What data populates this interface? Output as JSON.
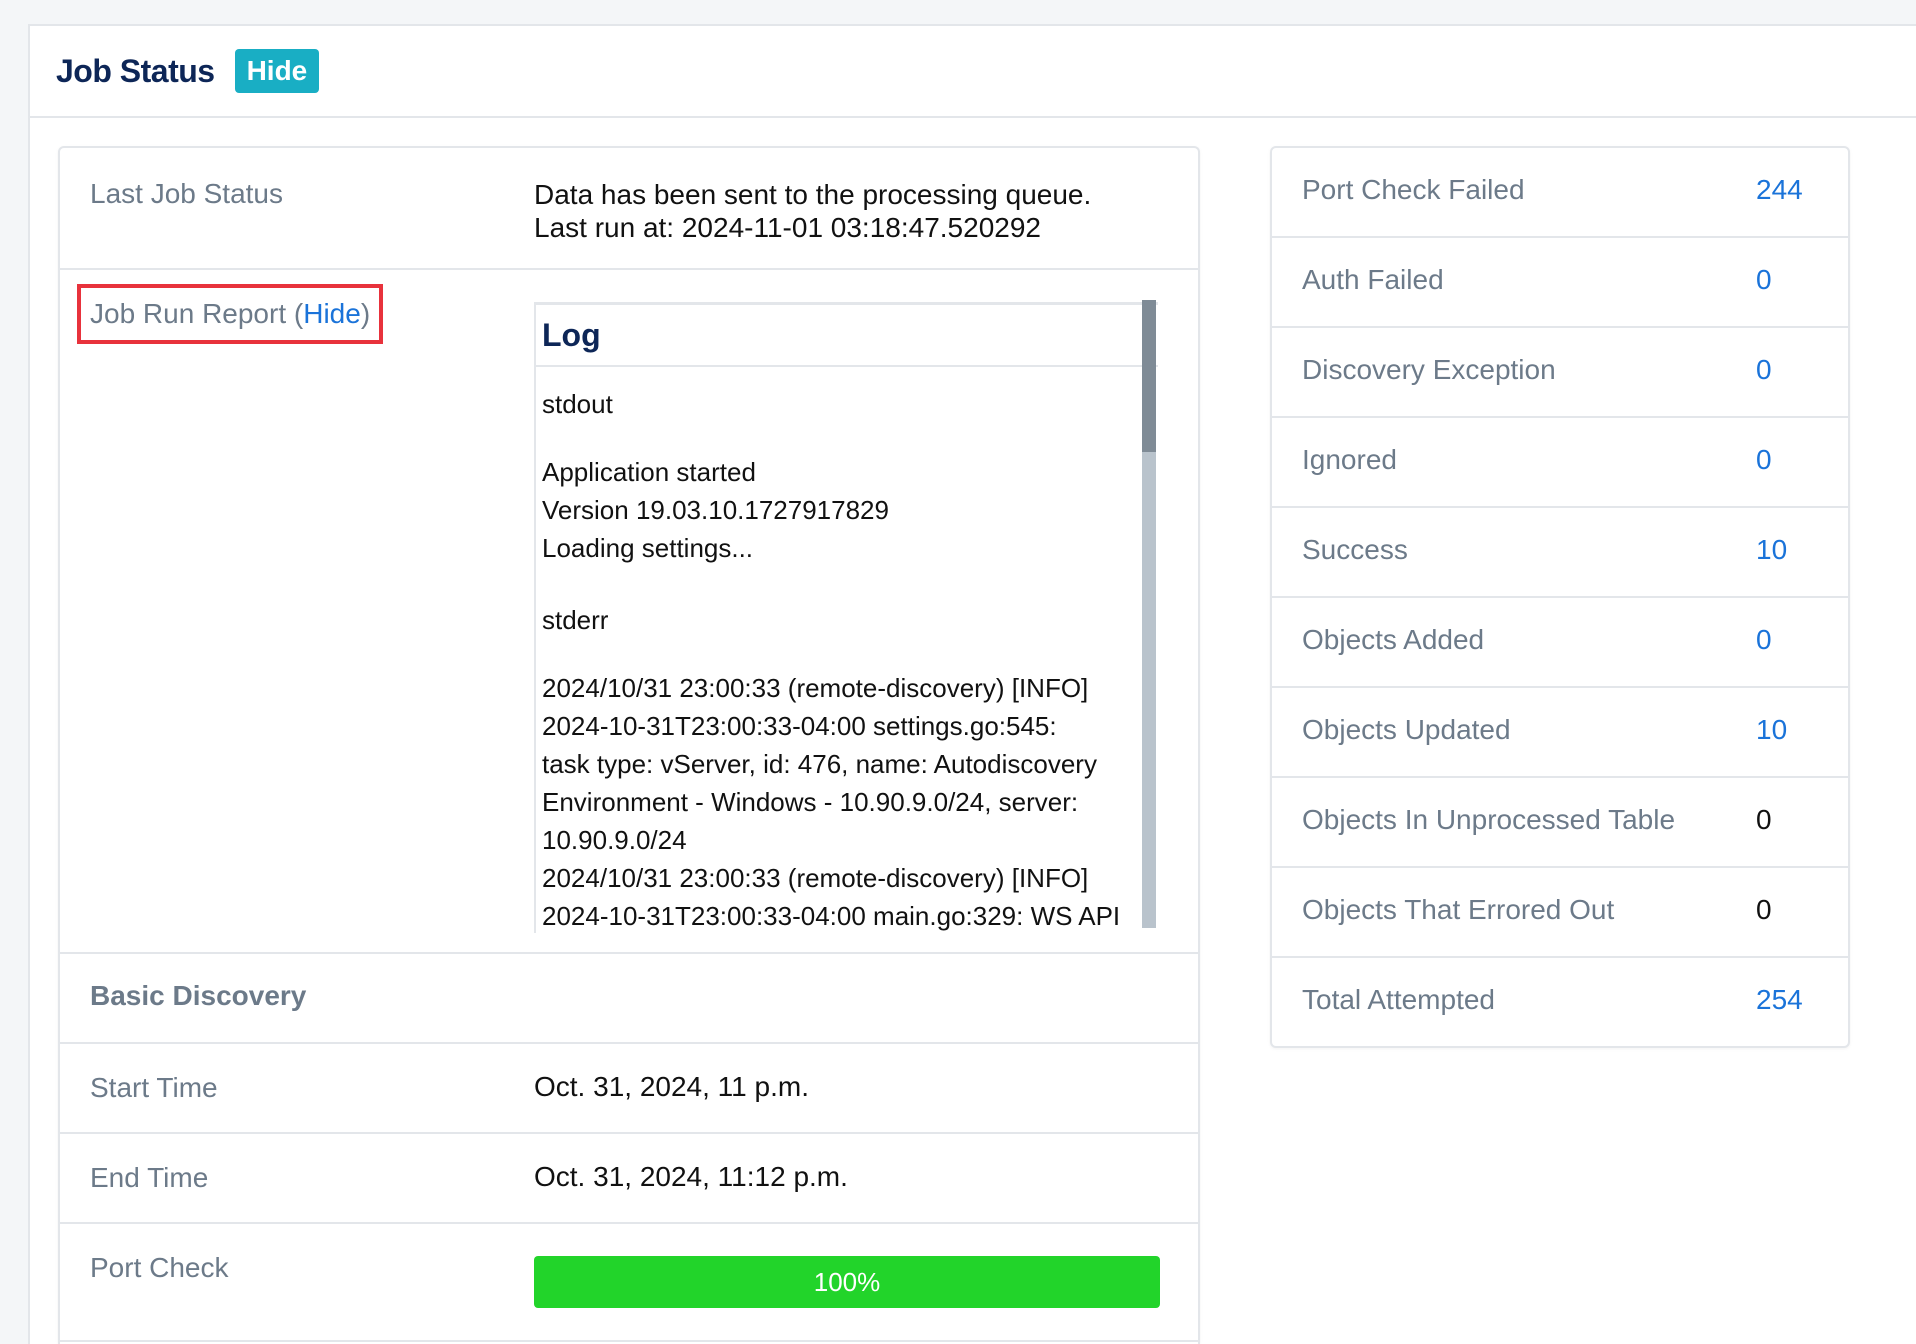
{
  "header": {
    "title": "Job Status",
    "hide_label": "Hide"
  },
  "last_job": {
    "label": "Last Job Status",
    "line1": "Data has been sent to the processing queue.",
    "line2": "Last run at: 2024-11-01 03:18:47.520292"
  },
  "job_run_report": {
    "label": "Job Run Report (",
    "hide_link": "Hide",
    "suffix": ")",
    "log": {
      "title": "Log",
      "stdout_label": "stdout",
      "stdout_lines": [
        "Application started",
        "Version 19.03.10.1727917829",
        "Loading settings..."
      ],
      "stderr_label": "stderr",
      "stderr_lines": [
        "2024/10/31 23:00:33 (remote-discovery) [INFO]",
        "2024-10-31T23:00:33-04:00 settings.go:545:",
        "task type: vServer, id: 476, name: Autodiscovery",
        "Environment - Windows - 10.90.9.0/24, server:",
        "10.90.9.0/24",
        "2024/10/31 23:00:33 (remote-discovery) [INFO]",
        "2024-10-31T23:00:33-04:00 main.go:329: WS API"
      ],
      "scroll_position": 0
    }
  },
  "basic_discovery": {
    "label": "Basic Discovery"
  },
  "start_time": {
    "label": "Start Time",
    "value": "Oct. 31, 2024, 11 p.m."
  },
  "end_time": {
    "label": "End Time",
    "value": "Oct. 31, 2024, 11:12 p.m."
  },
  "port_check": {
    "label": "Port Check",
    "progress_percent": 100,
    "progress_text": "100%",
    "color": "#22d42a"
  },
  "stats": [
    {
      "label": "Port Check Failed",
      "value": "244",
      "link": true
    },
    {
      "label": "Auth Failed",
      "value": "0",
      "link": true
    },
    {
      "label": "Discovery Exception",
      "value": "0",
      "link": true
    },
    {
      "label": "Ignored",
      "value": "0",
      "link": true
    },
    {
      "label": "Success",
      "value": "10",
      "link": true
    },
    {
      "label": "Objects Added",
      "value": "0",
      "link": true
    },
    {
      "label": "Objects Updated",
      "value": "10",
      "link": true
    },
    {
      "label": "Objects In Unprocessed Table",
      "value": "0",
      "link": false
    },
    {
      "label": "Objects That Errored Out",
      "value": "0",
      "link": false
    },
    {
      "label": "Total Attempted",
      "value": "254",
      "link": true
    }
  ],
  "colors": {
    "accent": "#19aec4",
    "link": "#1a73d9",
    "title": "#0d2657",
    "highlight": "#e8323c"
  }
}
